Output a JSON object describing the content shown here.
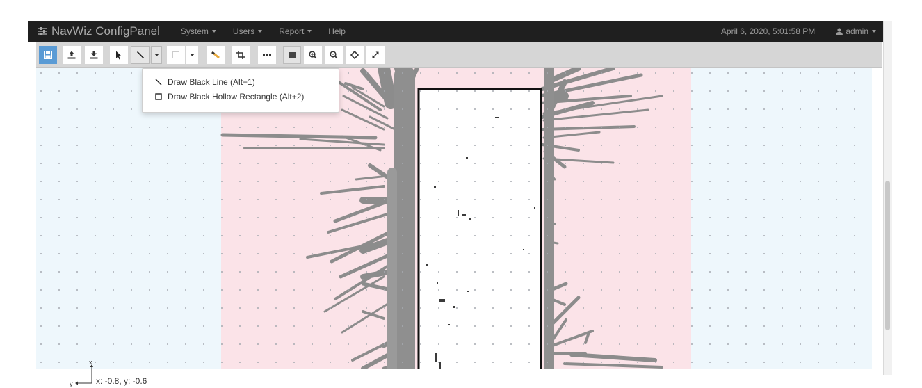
{
  "app": {
    "title": "NavWiz ConfigPanel"
  },
  "nav": {
    "menus": [
      {
        "label": "System"
      },
      {
        "label": "Users"
      },
      {
        "label": "Report"
      },
      {
        "label": "Help"
      }
    ],
    "datetime": "April 6, 2020, 5:01:58 PM",
    "user": "admin"
  },
  "toolbar": {
    "buttons": [
      {
        "name": "save",
        "icon": "floppy-icon"
      },
      {
        "name": "upload",
        "icon": "upload-icon"
      },
      {
        "name": "download",
        "icon": "download-icon"
      },
      {
        "name": "select",
        "icon": "pointer-icon"
      },
      {
        "name": "draw-line",
        "icon": "line-icon"
      },
      {
        "name": "draw-shape-dropdown",
        "icon": "caret-icon"
      },
      {
        "name": "draw-rectangle",
        "icon": "rectangle-icon"
      },
      {
        "name": "rectangle-dropdown",
        "icon": "caret-icon"
      },
      {
        "name": "eraser",
        "icon": "eraser-icon"
      },
      {
        "name": "crop",
        "icon": "crop-icon"
      },
      {
        "name": "more",
        "icon": "ellipsis-icon"
      },
      {
        "name": "fill",
        "icon": "square-icon"
      },
      {
        "name": "zoom-in",
        "icon": "zoom-in-icon"
      },
      {
        "name": "zoom-out",
        "icon": "zoom-out-icon"
      },
      {
        "name": "center",
        "icon": "diamond-icon"
      },
      {
        "name": "fullscreen",
        "icon": "expand-icon"
      }
    ]
  },
  "dropdown": {
    "items": [
      {
        "label": "Draw Black Line (Alt+1)",
        "icon": "line-icon"
      },
      {
        "label": "Draw Black Hollow Rectangle (Alt+2)",
        "icon": "rectangle-icon"
      }
    ]
  },
  "axes": {
    "x": "x",
    "y": "y"
  },
  "coordinates": "x: -0.8, y: -0.6",
  "colors": {
    "navbar": "#1f1f1f",
    "toolbar": "#d6d6d6",
    "active_button": "#5a9bd5",
    "map_outside": "#eef7fc",
    "map_region": "#fbe3e8",
    "obstacle": "#8c8c8c"
  }
}
